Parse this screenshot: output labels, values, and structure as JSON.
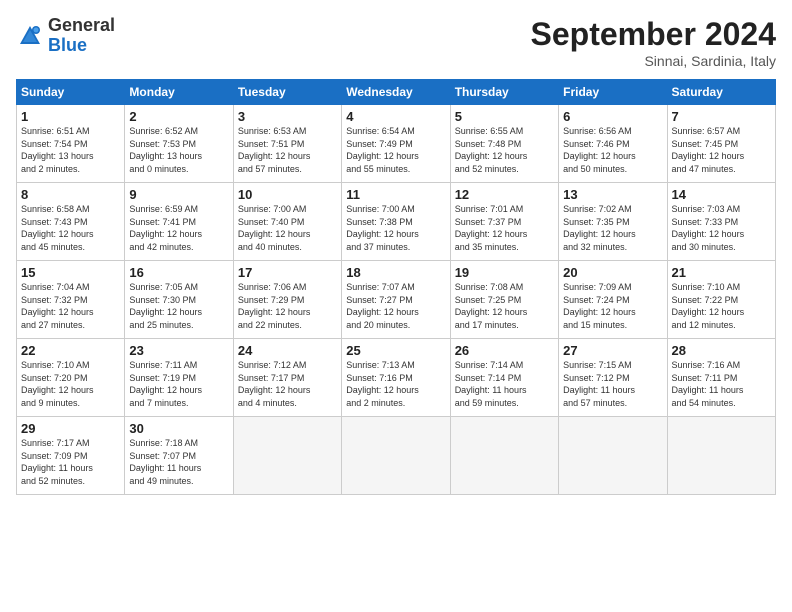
{
  "logo": {
    "general": "General",
    "blue": "Blue"
  },
  "header": {
    "title": "September 2024",
    "subtitle": "Sinnai, Sardinia, Italy"
  },
  "weekdays": [
    "Sunday",
    "Monday",
    "Tuesday",
    "Wednesday",
    "Thursday",
    "Friday",
    "Saturday"
  ],
  "weeks": [
    [
      {
        "day": "1",
        "info": "Sunrise: 6:51 AM\nSunset: 7:54 PM\nDaylight: 13 hours\nand 2 minutes."
      },
      {
        "day": "2",
        "info": "Sunrise: 6:52 AM\nSunset: 7:53 PM\nDaylight: 13 hours\nand 0 minutes."
      },
      {
        "day": "3",
        "info": "Sunrise: 6:53 AM\nSunset: 7:51 PM\nDaylight: 12 hours\nand 57 minutes."
      },
      {
        "day": "4",
        "info": "Sunrise: 6:54 AM\nSunset: 7:49 PM\nDaylight: 12 hours\nand 55 minutes."
      },
      {
        "day": "5",
        "info": "Sunrise: 6:55 AM\nSunset: 7:48 PM\nDaylight: 12 hours\nand 52 minutes."
      },
      {
        "day": "6",
        "info": "Sunrise: 6:56 AM\nSunset: 7:46 PM\nDaylight: 12 hours\nand 50 minutes."
      },
      {
        "day": "7",
        "info": "Sunrise: 6:57 AM\nSunset: 7:45 PM\nDaylight: 12 hours\nand 47 minutes."
      }
    ],
    [
      {
        "day": "8",
        "info": "Sunrise: 6:58 AM\nSunset: 7:43 PM\nDaylight: 12 hours\nand 45 minutes."
      },
      {
        "day": "9",
        "info": "Sunrise: 6:59 AM\nSunset: 7:41 PM\nDaylight: 12 hours\nand 42 minutes."
      },
      {
        "day": "10",
        "info": "Sunrise: 7:00 AM\nSunset: 7:40 PM\nDaylight: 12 hours\nand 40 minutes."
      },
      {
        "day": "11",
        "info": "Sunrise: 7:00 AM\nSunset: 7:38 PM\nDaylight: 12 hours\nand 37 minutes."
      },
      {
        "day": "12",
        "info": "Sunrise: 7:01 AM\nSunset: 7:37 PM\nDaylight: 12 hours\nand 35 minutes."
      },
      {
        "day": "13",
        "info": "Sunrise: 7:02 AM\nSunset: 7:35 PM\nDaylight: 12 hours\nand 32 minutes."
      },
      {
        "day": "14",
        "info": "Sunrise: 7:03 AM\nSunset: 7:33 PM\nDaylight: 12 hours\nand 30 minutes."
      }
    ],
    [
      {
        "day": "15",
        "info": "Sunrise: 7:04 AM\nSunset: 7:32 PM\nDaylight: 12 hours\nand 27 minutes."
      },
      {
        "day": "16",
        "info": "Sunrise: 7:05 AM\nSunset: 7:30 PM\nDaylight: 12 hours\nand 25 minutes."
      },
      {
        "day": "17",
        "info": "Sunrise: 7:06 AM\nSunset: 7:29 PM\nDaylight: 12 hours\nand 22 minutes."
      },
      {
        "day": "18",
        "info": "Sunrise: 7:07 AM\nSunset: 7:27 PM\nDaylight: 12 hours\nand 20 minutes."
      },
      {
        "day": "19",
        "info": "Sunrise: 7:08 AM\nSunset: 7:25 PM\nDaylight: 12 hours\nand 17 minutes."
      },
      {
        "day": "20",
        "info": "Sunrise: 7:09 AM\nSunset: 7:24 PM\nDaylight: 12 hours\nand 15 minutes."
      },
      {
        "day": "21",
        "info": "Sunrise: 7:10 AM\nSunset: 7:22 PM\nDaylight: 12 hours\nand 12 minutes."
      }
    ],
    [
      {
        "day": "22",
        "info": "Sunrise: 7:10 AM\nSunset: 7:20 PM\nDaylight: 12 hours\nand 9 minutes."
      },
      {
        "day": "23",
        "info": "Sunrise: 7:11 AM\nSunset: 7:19 PM\nDaylight: 12 hours\nand 7 minutes."
      },
      {
        "day": "24",
        "info": "Sunrise: 7:12 AM\nSunset: 7:17 PM\nDaylight: 12 hours\nand 4 minutes."
      },
      {
        "day": "25",
        "info": "Sunrise: 7:13 AM\nSunset: 7:16 PM\nDaylight: 12 hours\nand 2 minutes."
      },
      {
        "day": "26",
        "info": "Sunrise: 7:14 AM\nSunset: 7:14 PM\nDaylight: 11 hours\nand 59 minutes."
      },
      {
        "day": "27",
        "info": "Sunrise: 7:15 AM\nSunset: 7:12 PM\nDaylight: 11 hours\nand 57 minutes."
      },
      {
        "day": "28",
        "info": "Sunrise: 7:16 AM\nSunset: 7:11 PM\nDaylight: 11 hours\nand 54 minutes."
      }
    ],
    [
      {
        "day": "29",
        "info": "Sunrise: 7:17 AM\nSunset: 7:09 PM\nDaylight: 11 hours\nand 52 minutes."
      },
      {
        "day": "30",
        "info": "Sunrise: 7:18 AM\nSunset: 7:07 PM\nDaylight: 11 hours\nand 49 minutes."
      },
      {
        "day": "",
        "info": ""
      },
      {
        "day": "",
        "info": ""
      },
      {
        "day": "",
        "info": ""
      },
      {
        "day": "",
        "info": ""
      },
      {
        "day": "",
        "info": ""
      }
    ]
  ]
}
